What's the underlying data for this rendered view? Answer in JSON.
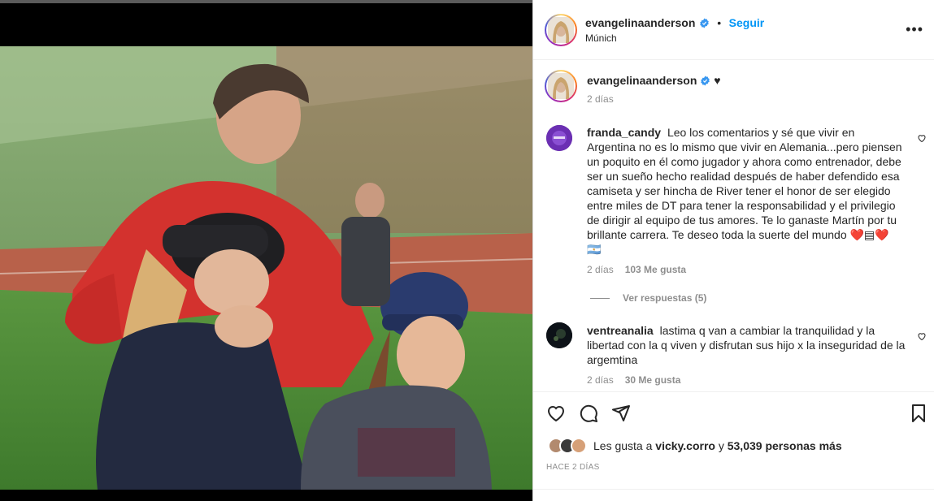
{
  "post_header": {
    "username": "evangelinaanderson",
    "separator": "•",
    "follow_label": "Seguir",
    "location": "Múnich",
    "more_label": "•••"
  },
  "caption": {
    "username": "evangelinaanderson",
    "text": "♥",
    "time": "2 días"
  },
  "comments": [
    {
      "username": "franda_candy",
      "text": "Leo los comentarios y sé que vivir en Argentina no es lo mismo que vivir en Alemania...pero piensen un poquito en él como jugador y ahora como entrenador, debe ser un sueño hecho realidad después de haber defendido esa camiseta y ser hincha de River tener el honor de ser elegido entre miles de DT para tener la responsabilidad y el privilegio de dirigir al equipo de tus amores. Te lo ganaste Martín por tu brillante carrera. Te deseo toda la suerte del mundo ❤️▤❤️ 🇦🇷",
      "time": "2 días",
      "likes": "103 Me gusta",
      "replies": "Ver respuestas (5)"
    },
    {
      "username": "ventreanalia",
      "text": "lastima q van a cambiar la tranquilidad y la libertad con la q viven y disfrutan sus hijo x la inseguridad de la argemtina",
      "time": "2 días",
      "likes": "30 Me gusta"
    }
  ],
  "likes": {
    "prefix": "Les gusta a",
    "user": "vicky.corro",
    "middle": "y",
    "count": "53,039 personas más"
  },
  "posted": "HACE 2 DÍAS",
  "icons": {
    "like": "heart-icon",
    "comment": "comment-icon",
    "share": "paper-plane-icon",
    "save": "bookmark-icon",
    "verified": "verified-badge-icon",
    "more": "more-options-icon"
  },
  "colors": {
    "accent": "#0095f6",
    "text": "#262626",
    "muted": "#8e8e8e",
    "verified": "#3897f0"
  }
}
